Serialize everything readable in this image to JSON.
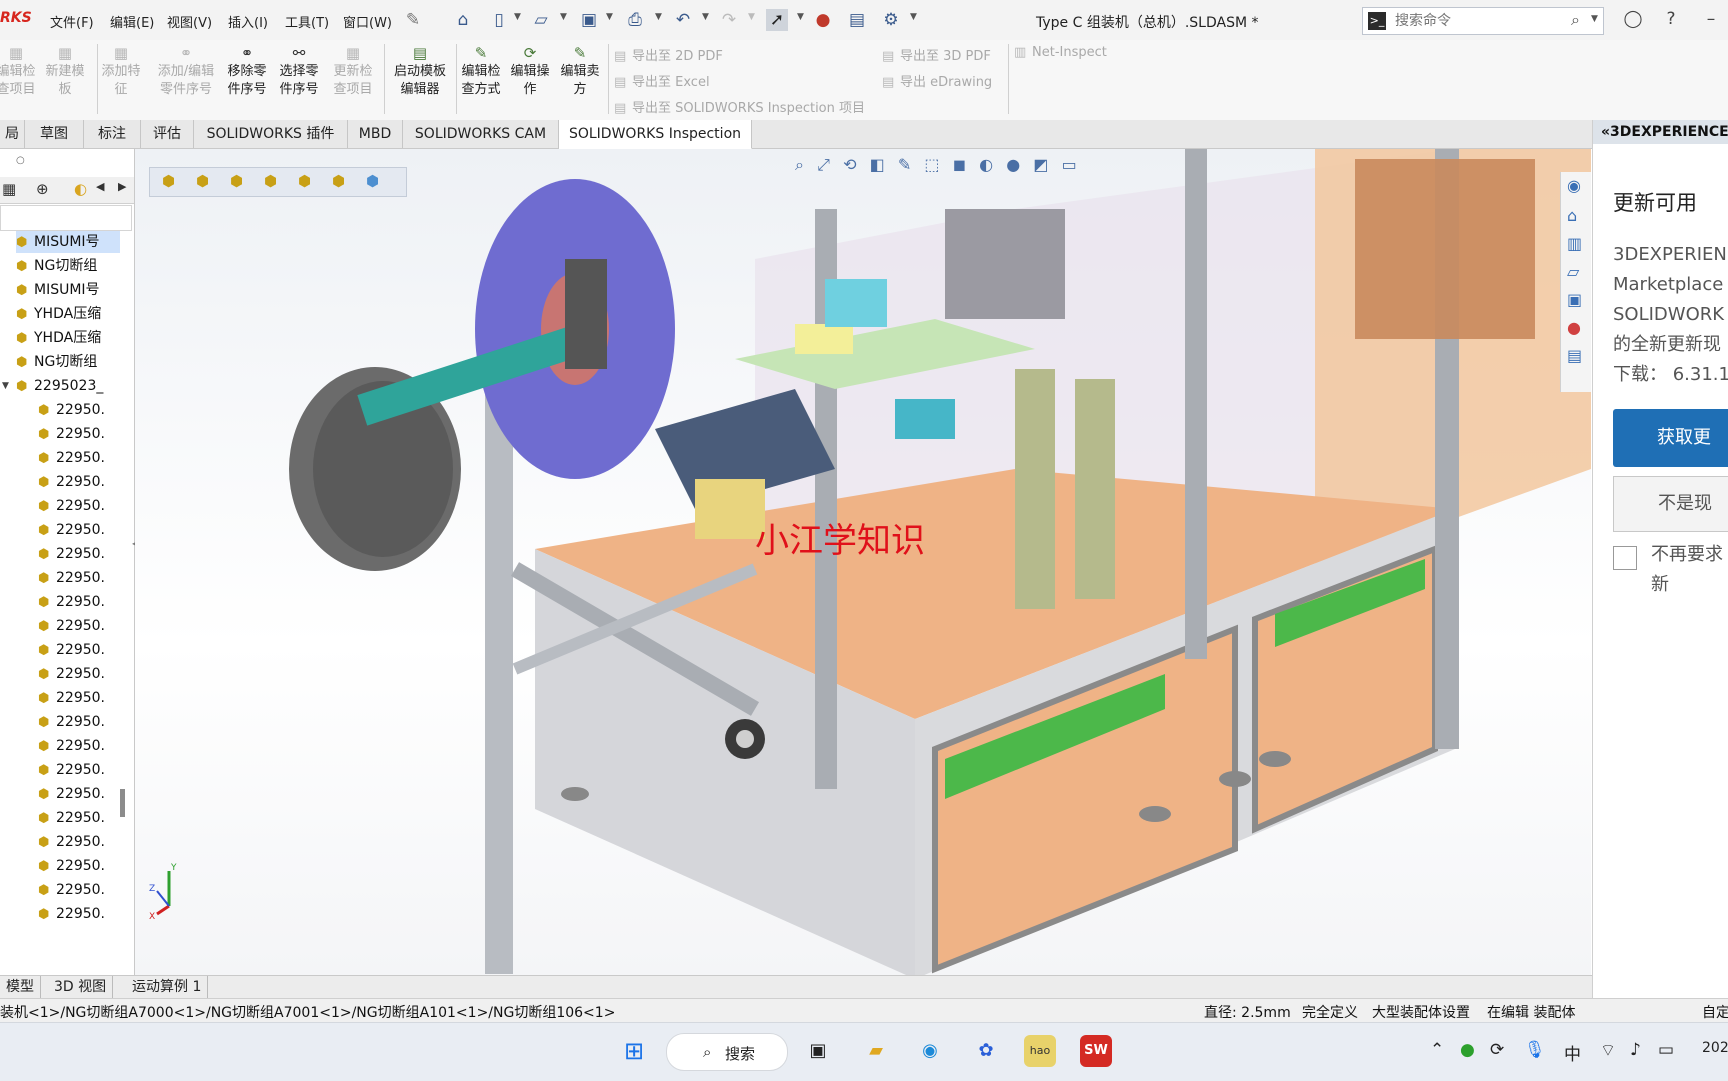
{
  "app": {
    "logo_text": "RKS",
    "doc_title": "Type C 组装机（总机）.SLDASM *"
  },
  "menu": {
    "items": [
      "文件(F)",
      "编辑(E)",
      "视图(V)",
      "插入(I)",
      "工具(T)",
      "窗口(W)"
    ]
  },
  "search": {
    "placeholder": "搜索命令"
  },
  "ribbon": {
    "buttons": [
      {
        "label": "编辑检\n查项目",
        "enabled": false
      },
      {
        "label": "新建模\n板",
        "enabled": false
      },
      {
        "label": "添加特\n征",
        "enabled": false
      },
      {
        "label": "添加/编辑\n零件序号",
        "enabled": false
      },
      {
        "label": "移除零\n件序号",
        "enabled": true
      },
      {
        "label": "选择零\n件序号",
        "enabled": true
      },
      {
        "label": "更新检\n查项目",
        "enabled": false
      },
      {
        "label": "启动模板\n编辑器",
        "enabled": true
      },
      {
        "label": "编辑检\n查方式",
        "enabled": true
      },
      {
        "label": "编辑操\n作",
        "enabled": true
      },
      {
        "label": "编辑卖\n方",
        "enabled": true
      }
    ],
    "export": {
      "pdf2d": "导出至 2D PDF",
      "excel": "导出至 Excel",
      "inspection": "导出至 SOLIDWORKS Inspection 项目",
      "pdf3d": "导出至 3D PDF",
      "edrawing": "导出 eDrawing",
      "netinspect": "Net-Inspect"
    }
  },
  "tabs": [
    "局",
    "草图",
    "标注",
    "评估",
    "SOLIDWORKS 插件",
    "MBD",
    "SOLIDWORKS CAM",
    "SOLIDWORKS Inspection"
  ],
  "active_tab": "SOLIDWORKS Inspection",
  "tree": {
    "items": [
      {
        "label": "MISUMI号",
        "selected": true
      },
      {
        "label": "NG切断组"
      },
      {
        "label": "MISUMI号"
      },
      {
        "label": "YHDA压缩"
      },
      {
        "label": "YHDA压缩"
      },
      {
        "label": "NG切断组"
      },
      {
        "label": "2295023_"
      },
      {
        "label": "22950."
      },
      {
        "label": "22950."
      },
      {
        "label": "22950."
      },
      {
        "label": "22950."
      },
      {
        "label": "22950."
      },
      {
        "label": "22950."
      },
      {
        "label": "22950."
      },
      {
        "label": "22950."
      },
      {
        "label": "22950."
      },
      {
        "label": "22950."
      },
      {
        "label": "22950."
      },
      {
        "label": "22950."
      },
      {
        "label": "22950."
      },
      {
        "label": "22950."
      },
      {
        "label": "22950."
      },
      {
        "label": "22950."
      },
      {
        "label": "22950."
      },
      {
        "label": "22950."
      },
      {
        "label": "22950."
      },
      {
        "label": "22950."
      },
      {
        "label": "22950."
      },
      {
        "label": "22950."
      }
    ]
  },
  "model_tabs": [
    "模型",
    "3D 视图",
    "运动算例 1"
  ],
  "viewport": {
    "watermark": "小江学知识"
  },
  "statusbar": {
    "path": "装机<1>/NG切断组A7000<1>/NG切断组A7001<1>/NG切断组A101<1>/NG切断组106<1>",
    "diameter": "直径: 2.5mm",
    "state": "完全定义",
    "assembly": "大型装配体设置",
    "editing": "在编辑 装配体",
    "custom": "自定"
  },
  "taskpane": {
    "header": "3DEXPERIENCE",
    "title": "更新可用",
    "body": [
      "3DEXPERIEN",
      "Marketplace",
      "SOLIDWORK",
      "的全新更新现",
      "下载：  6.31.1"
    ],
    "primary_btn": "获取更",
    "secondary_btn": "不是现",
    "checkbox_label": [
      "不再要求",
      "新"
    ]
  },
  "taskbar": {
    "search": "搜索",
    "ime": "中",
    "year": "202"
  }
}
